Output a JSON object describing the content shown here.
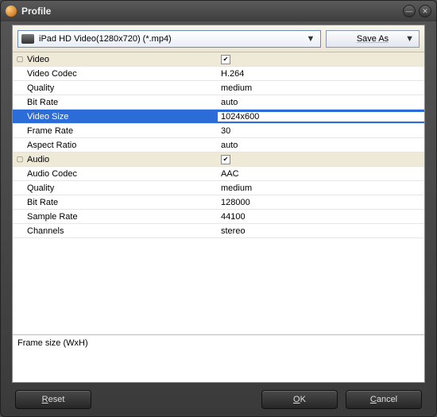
{
  "window": {
    "title": "Profile"
  },
  "toolbar": {
    "profile_selected": "iPad HD Video(1280x720) (*.mp4)",
    "save_as_label": "Save As"
  },
  "groups": {
    "video": {
      "label": "Video",
      "checked": true,
      "props": {
        "codec": {
          "label": "Video Codec",
          "value": "H.264"
        },
        "quality": {
          "label": "Quality",
          "value": "medium"
        },
        "bitrate": {
          "label": "Bit Rate",
          "value": "auto"
        },
        "size": {
          "label": "Video Size",
          "value": "1024x600"
        },
        "framerate": {
          "label": "Frame Rate",
          "value": "30"
        },
        "aspect": {
          "label": "Aspect Ratio",
          "value": "auto"
        }
      }
    },
    "audio": {
      "label": "Audio",
      "checked": true,
      "props": {
        "codec": {
          "label": "Audio Codec",
          "value": "AAC"
        },
        "quality": {
          "label": "Quality",
          "value": "medium"
        },
        "bitrate": {
          "label": "Bit Rate",
          "value": "128000"
        },
        "samplerate": {
          "label": "Sample Rate",
          "value": "44100"
        },
        "channels": {
          "label": "Channels",
          "value": "stereo"
        }
      }
    }
  },
  "description": "Frame size (WxH)",
  "buttons": {
    "reset": "Reset",
    "ok": "OK",
    "cancel": "Cancel"
  }
}
